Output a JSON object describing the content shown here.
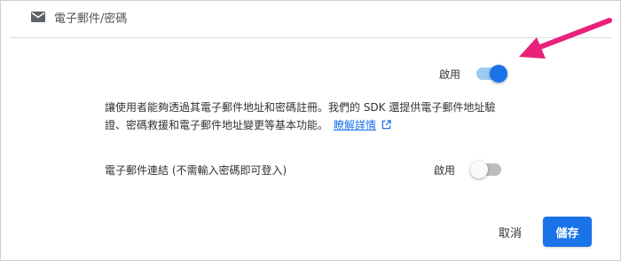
{
  "section": {
    "title": "電子郵件/密碼",
    "icon": "mail-icon"
  },
  "email_password": {
    "enable_label": "啟用",
    "enabled": true
  },
  "description": {
    "text": "讓使用者能夠透過其電子郵件地址和密碼註冊。我們的 SDK 還提供電子郵件地址驗證、密碼救援和電子郵件地址變更等基本功能。",
    "learn_more": "瞭解詳情",
    "link_icon": "external-link-icon"
  },
  "email_link": {
    "label": "電子郵件連結 (不需輸入密碼即可登入)",
    "enable_label": "啟用",
    "enabled": false
  },
  "actions": {
    "cancel": "取消",
    "save": "儲存"
  },
  "colors": {
    "accent": "#1a73e8",
    "toggle_track_on": "#9ccbef",
    "annotation_arrow": "#e8227a"
  }
}
